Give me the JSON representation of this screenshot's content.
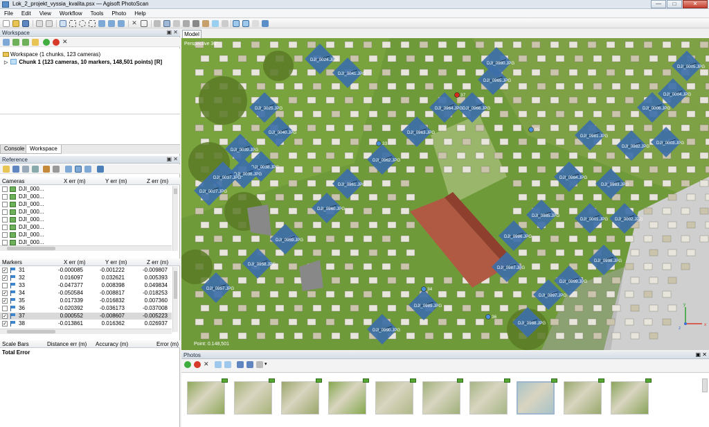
{
  "window": {
    "title": "Lok_2_projekt_vyssia_kvalita.psx — Agisoft PhotoScan",
    "minimize": "—",
    "maximize": "□",
    "close": "✕"
  },
  "menu": [
    "File",
    "Edit",
    "View",
    "Workflow",
    "Tools",
    "Photo",
    "Help"
  ],
  "workspace": {
    "header": "Workspace",
    "header_buttons": "▣ ✕",
    "root": "Workspace (1 chunks, 123 cameras)",
    "chunk": "Chunk 1 (123 cameras, 10 markers, 148,501 points) [R]"
  },
  "tabs": [
    "Console",
    "Workspace"
  ],
  "reference": {
    "header": "Reference",
    "header_buttons": "▣ ✕",
    "cameras_header": [
      "Cameras",
      "X err (m)",
      "Y err (m)",
      "Z err (m)"
    ],
    "cameras": [
      "DJI_000...",
      "DJI_000...",
      "DJI_000...",
      "DJI_000...",
      "DJI_000...",
      "DJI_000...",
      "DJI_000...",
      "DJI_000..."
    ],
    "markers_header": [
      "Markers",
      "X err (m)",
      "Y err (m)",
      "Z err (m)"
    ],
    "markers": [
      {
        "name": "31",
        "checked": "✓",
        "x": "-0.000085",
        "y": "-0.001222",
        "z": "-0.009807"
      },
      {
        "name": "32",
        "checked": "✓",
        "x": "0.016097",
        "y": "0.032621",
        "z": "0.005393"
      },
      {
        "name": "33",
        "checked": "",
        "x": "-0.047377",
        "y": "0.008398",
        "z": "0.049834"
      },
      {
        "name": "34",
        "checked": "✓",
        "x": "-0.050584",
        "y": "-0.008817",
        "z": "-0.018253"
      },
      {
        "name": "35",
        "checked": "✓",
        "x": "0.017339",
        "y": "-0.016832",
        "z": "0.007360"
      },
      {
        "name": "36",
        "checked": "",
        "x": "-0.020392",
        "y": "-0.036173",
        "z": "-0.037008"
      },
      {
        "name": "37",
        "checked": "✓",
        "x": "0.000552",
        "y": "-0.008607",
        "z": "-0.005223"
      },
      {
        "name": "38",
        "checked": "✓",
        "x": "-0.013861",
        "y": "0.016362",
        "z": "0.026937"
      }
    ],
    "scalebars_header": [
      "Scale Bars",
      "Distance err (m)",
      "Accuracy (m)",
      "Error (m)"
    ],
    "total_error": "Total Error"
  },
  "model": {
    "tab": "Model",
    "view_label": "Perspective 30°",
    "status_text": "Point: 0.148,501",
    "camera_labels": [
      "DJI_0024.JPG",
      "DJI_0041.JPG",
      "DJI_0025.JPG",
      "DJI_0040.JPG",
      "DJI_0039.JPG",
      "DJI_0038.JPG",
      "DJI_0036.JPG",
      "DJI_0037.JPG",
      "DJI_0027.JPG",
      "DJI_0966.JPG",
      "DJI_0965.JPG",
      "DJI_0964.JPG",
      "DJI_0963.JPG",
      "DJI_0962.JPG",
      "DJI_0961.JPG",
      "DJI_0960.JPG",
      "DJI_0959.JPG",
      "DJI_0958.JPG",
      "DJI_0957.JPG",
      "DJI_0989.JPG",
      "DJI_0990.JPG",
      "DJI_0988.JPG",
      "DJI_0987.JPG",
      "DJI_0986.JPG",
      "DJI_0985.JPG",
      "DJI_0984.JPG",
      "DJI_0983.JPG",
      "DJI_0982.JPG",
      "DJI_0981.JPG",
      "DJI_0001.JPG",
      "DJI_0002.JPG",
      "DJI_0003.JPG",
      "DJI_0004.JPG",
      "DJI_0005.JPG",
      "DJI_0006.JPG",
      "DJI_0997.JPG",
      "DJI_0999.JPG",
      "DJI_0998.JPG",
      "DJI_0980.JPG"
    ],
    "marker_labels": [
      "37",
      "33",
      "34",
      "35",
      "36"
    ],
    "axis": {
      "x": "x",
      "y": "y",
      "z": "z"
    }
  },
  "photos": {
    "header": "Photos",
    "header_buttons": "▣ ✕",
    "thumb_count": 10
  },
  "colors": {
    "camera_plane": "#3d6fa8",
    "grass": "#6f9a3a",
    "roof": "#b05a44",
    "marker_red": "#d82a1a",
    "marker_blue": "#4a90d9"
  }
}
